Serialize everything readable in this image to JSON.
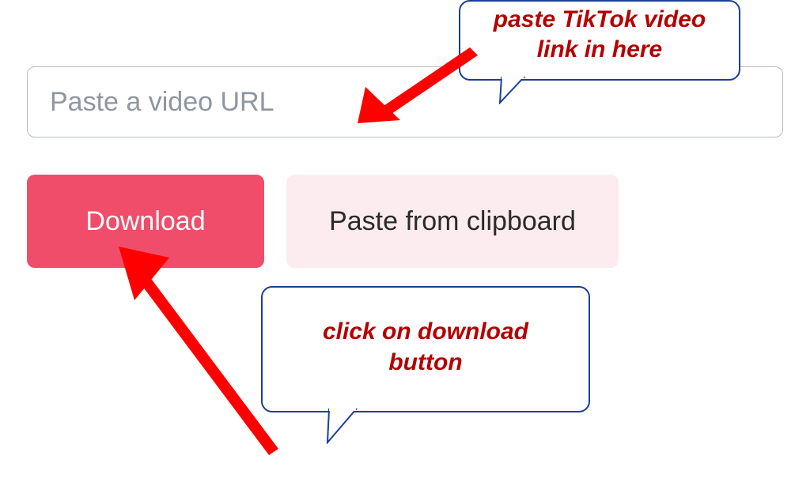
{
  "input": {
    "placeholder": "Paste a video URL",
    "value": ""
  },
  "buttons": {
    "download": "Download",
    "paste": "Paste from clipboard"
  },
  "annotations": {
    "top_line1": "paste TikTok video",
    "top_line2": "link in here",
    "bottom_line1": "click on download",
    "bottom_line2": "button"
  },
  "colors": {
    "accent": "#ef4d6a",
    "accent_light": "#fdecef",
    "callout_border": "#1b3f93",
    "annotation_text": "#b40101",
    "arrow": "#ff0000"
  }
}
